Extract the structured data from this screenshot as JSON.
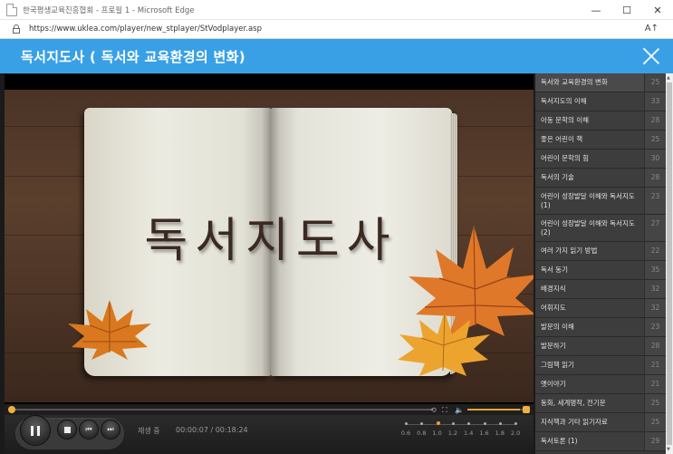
{
  "browser": {
    "window_title": "한국평생교육진흥협회 - 프로필 1 - Microsoft Edge",
    "url": "https://www.uklea.com/player/new_stplayer/StVodplayer.asp",
    "read_aloud_icon": "A↑",
    "minimize": "—",
    "maximize": "☐",
    "close": "✕"
  },
  "player": {
    "title": "독서지도사 ( 독서와 교육환경의 변화)",
    "video_text": "독서지도사",
    "status": "재생 중",
    "time": "00:00:07 / 00:18:24",
    "progress": 0.006,
    "volume": 0.9,
    "speed_options": [
      "0.6",
      "0.8",
      "1.0",
      "1.2",
      "1.4",
      "1.6",
      "1.8",
      "2.0"
    ],
    "speed_selected": "1.0",
    "accent_color": "#3aa0e6",
    "progress_color": "#e8a23a"
  },
  "playlist": [
    {
      "title": "독서와 교육환경의 변화",
      "num": "25"
    },
    {
      "title": "독서지도의 이해",
      "num": "33"
    },
    {
      "title": "아동 문학의 이해",
      "num": "28"
    },
    {
      "title": "좋은 어린이 책",
      "num": "25"
    },
    {
      "title": "어린이 문학의 힘",
      "num": "30"
    },
    {
      "title": "독서의 기술",
      "num": "28"
    },
    {
      "title": "어린이 성장발달 이해와 독서지도 (1)",
      "num": "23"
    },
    {
      "title": "어린이 성장발달 이해와 독서지도 (2)",
      "num": "27"
    },
    {
      "title": "여러 가지 읽기 방법",
      "num": "22"
    },
    {
      "title": "독서 동기",
      "num": "35"
    },
    {
      "title": "배경지식",
      "num": "32"
    },
    {
      "title": "어휘지도",
      "num": "32"
    },
    {
      "title": "발문의 이해",
      "num": "23"
    },
    {
      "title": "발문하기",
      "num": "28"
    },
    {
      "title": "그림책 읽기",
      "num": "21"
    },
    {
      "title": "옛이야기",
      "num": "21"
    },
    {
      "title": "동화, 세계명작, 전기문",
      "num": "25"
    },
    {
      "title": "지식책과 기타 읽기자료",
      "num": "25"
    },
    {
      "title": "독서토론 (1)",
      "num": "29"
    }
  ]
}
